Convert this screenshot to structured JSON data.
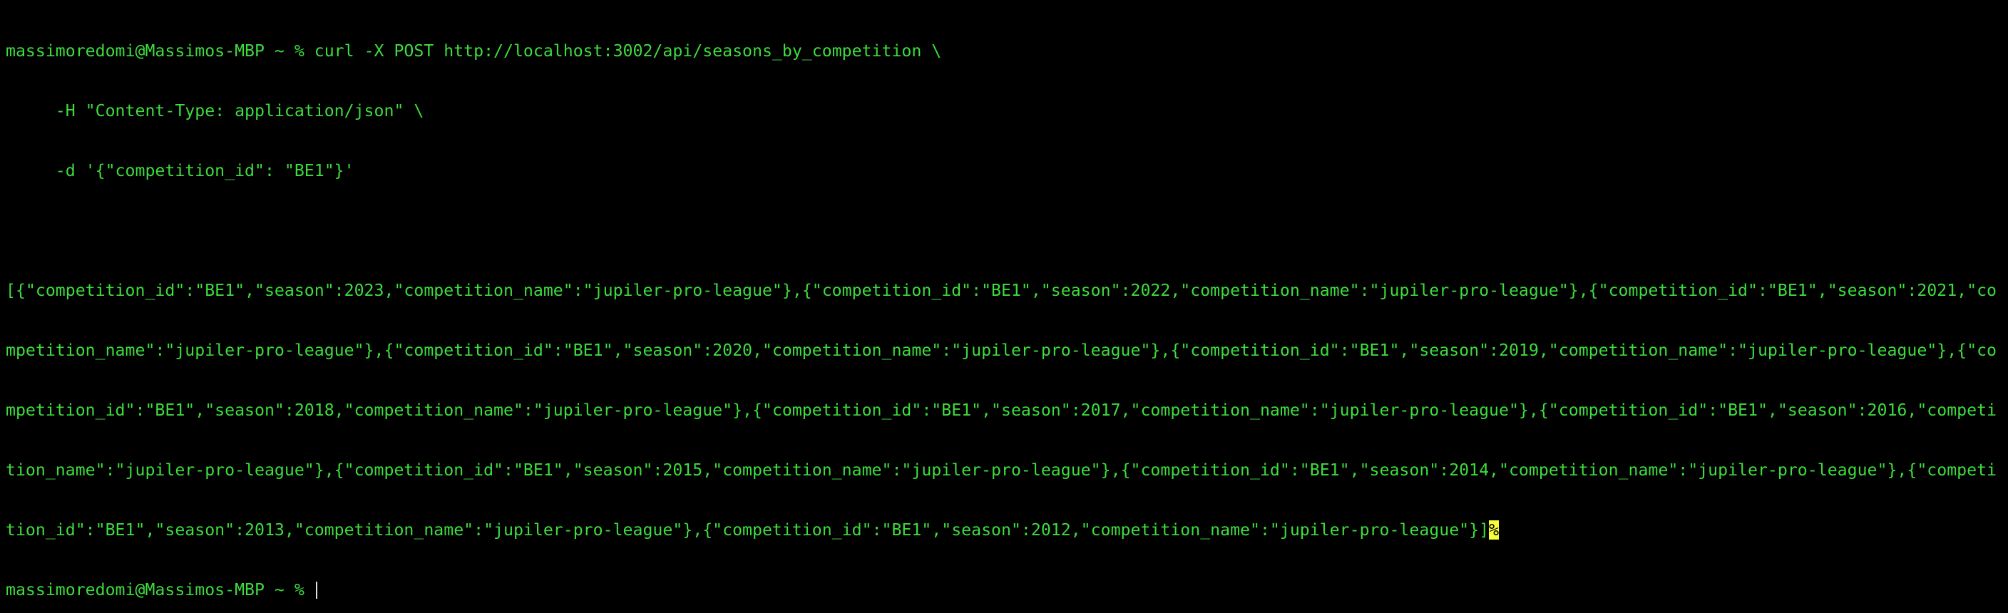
{
  "terminal": {
    "colors": {
      "background": "#000000",
      "text": "#3ddc3d",
      "cursor_highlight": "#f7ff3a"
    },
    "command": {
      "prompt": "massimoredomi@Massimos-MBP ~ % ",
      "line1": "curl -X POST http://localhost:3002/api/seasons_by_competition \\",
      "line2": "     -H \"Content-Type: application/json\" \\",
      "line3": "     -d '{\"competition_id\": \"BE1\"}'"
    },
    "output": {
      "lines": [
        "[{\"competition_id\":\"BE1\",\"season\":2023,\"competition_name\":\"jupiler-pro-league\"},{\"competition_id\":\"BE1\",\"season\":2022,\"competition_name\":\"jupiler-pro-league\"},{\"competition_id\":\"BE1\",\"season\":2021,\"co",
        "mpetition_name\":\"jupiler-pro-league\"},{\"competition_id\":\"BE1\",\"season\":2020,\"competition_name\":\"jupiler-pro-league\"},{\"competition_id\":\"BE1\",\"season\":2019,\"competition_name\":\"jupiler-pro-league\"},{\"co",
        "mpetition_id\":\"BE1\",\"season\":2018,\"competition_name\":\"jupiler-pro-league\"},{\"competition_id\":\"BE1\",\"season\":2017,\"competition_name\":\"jupiler-pro-league\"},{\"competition_id\":\"BE1\",\"season\":2016,\"competi",
        "tion_name\":\"jupiler-pro-league\"},{\"competition_id\":\"BE1\",\"season\":2015,\"competition_name\":\"jupiler-pro-league\"},{\"competition_id\":\"BE1\",\"season\":2014,\"competition_name\":\"jupiler-pro-league\"},{\"competi",
        "tion_id\":\"BE1\",\"season\":2013,\"competition_name\":\"jupiler-pro-league\"},{\"competition_id\":\"BE1\",\"season\":2012,\"competition_name\":\"jupiler-pro-league\"}]"
      ],
      "no_newline_marker": "%"
    },
    "next_prompt": "massimoredomi@Massimos-MBP ~ % "
  }
}
